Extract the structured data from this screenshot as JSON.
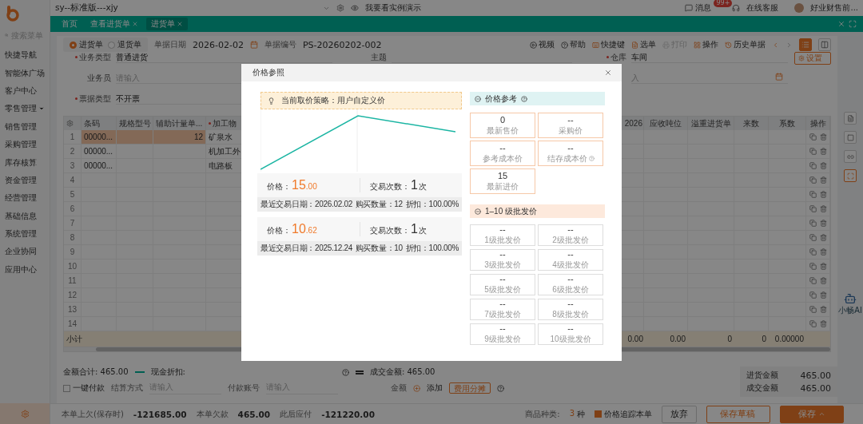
{
  "topbar": {
    "account": "sy--标准版---xjy",
    "demo": "我要看实例演示",
    "messages": "消息",
    "badge": "99+",
    "service": "在线客服",
    "user": "好业财售前..."
  },
  "sidebar": {
    "search_placeholder": "搜索菜单",
    "items": [
      {
        "label": "快捷导航",
        "kind": "item"
      },
      {
        "label": "智能体广场",
        "kind": "item"
      },
      {
        "label": "客户中心",
        "kind": "item"
      },
      {
        "label": "零售管理",
        "kind": "submenu"
      },
      {
        "label": "销售管理",
        "kind": "item"
      },
      {
        "label": "采购管理",
        "kind": "item"
      },
      {
        "label": "库存核算",
        "kind": "item"
      },
      {
        "label": "资金管理",
        "kind": "item"
      },
      {
        "label": "经营管理",
        "kind": "item"
      },
      {
        "label": "基础信息",
        "kind": "item"
      },
      {
        "label": "系统管理",
        "kind": "item"
      },
      {
        "label": "企业协同",
        "kind": "item"
      },
      {
        "label": "应用中心",
        "kind": "item"
      }
    ]
  },
  "tabs": [
    {
      "label": "首页",
      "selected": false,
      "closable": false
    },
    {
      "label": "查看进货单",
      "selected": false,
      "closable": true
    },
    {
      "label": "进货单",
      "selected": true,
      "closable": true
    }
  ],
  "form": {
    "types": [
      {
        "label": "进货单",
        "selected": true
      },
      {
        "label": "退货单",
        "selected": false
      }
    ],
    "date_label": "单据日期",
    "date": "2026-02-02",
    "number_label": "单据编号",
    "number": "PS-20260202-002",
    "actions": [
      {
        "label": "视频",
        "kind": "link",
        "disabled": false
      },
      {
        "label": "帮助",
        "kind": "link",
        "disabled": false
      },
      {
        "label": "快捷键",
        "kind": "tool",
        "disabled": false
      },
      {
        "label": "选单",
        "kind": "tool",
        "disabled": false
      },
      {
        "label": "打印",
        "kind": "tool",
        "disabled": true
      },
      {
        "label": "操作",
        "kind": "tool",
        "disabled": false
      },
      {
        "label": "历史单据",
        "kind": "tool",
        "disabled": false
      }
    ],
    "settings_button": "设置",
    "field_rows": [
      {
        "fields": [
          {
            "label": "业务类型",
            "value": "普通进货",
            "required": true,
            "kind": "text"
          },
          {
            "label": "主题",
            "required": false,
            "kind": "text"
          },
          {
            "label": "仓库",
            "value": "车间",
            "required": true,
            "kind": "text"
          }
        ]
      },
      {
        "fields": [
          {
            "label": "业务员",
            "placeholder": "请输入",
            "required": false,
            "kind": "text"
          },
          {
            "placeholder": "入",
            "required": false,
            "kind": "date"
          }
        ]
      },
      {
        "fields": [
          {
            "label": "票据类型",
            "value": "不开票",
            "required": true,
            "kind": "text"
          }
        ]
      }
    ]
  },
  "table": {
    "columns": [
      {
        "label": "条码"
      },
      {
        "label": "规格型号"
      },
      {
        "label": "辅助计量单..."
      },
      {
        "label": "加工物",
        "required": true
      },
      {
        "label": "2026"
      },
      {
        "label": "应收吨位"
      },
      {
        "label": "溢重进货单"
      },
      {
        "label": "来数"
      },
      {
        "label": "系数"
      },
      {
        "label": "操作"
      }
    ],
    "rows": [
      {
        "no": "1",
        "barcode": "00000...",
        "aux_qty": "12",
        "item": "矿泉水",
        "selected": true
      },
      {
        "no": "2",
        "barcode": "00000...",
        "item": "机加工外",
        "selected": false
      },
      {
        "no": "3",
        "barcode": "00000...",
        "item": "电路板",
        "selected": false
      },
      {
        "no": "4",
        "selected": false
      },
      {
        "no": "5",
        "selected": false
      },
      {
        "no": "6",
        "selected": false
      },
      {
        "no": "7",
        "selected": false
      },
      {
        "no": "8",
        "selected": false
      },
      {
        "no": "9",
        "selected": false
      },
      {
        "no": "10",
        "selected": false
      },
      {
        "no": "11",
        "selected": false
      },
      {
        "no": "12",
        "selected": false
      },
      {
        "no": "13",
        "selected": false
      },
      {
        "no": "14",
        "selected": false
      }
    ],
    "subtotal": {
      "label": "小计",
      "values": [
        "0.00",
        "0.00",
        "0",
        "0",
        "0.00000"
      ]
    }
  },
  "summary": {
    "total": "金额合计: 465.00",
    "discount": "现金折扣:",
    "deal": "成交金额: 465.00",
    "one_click": {
      "label": "一键付款",
      "checked": false
    },
    "method_label": "结算方式",
    "method_placeholder": "请输入",
    "account_label": "付款账号",
    "account_placeholder": "请输入",
    "amount_label": "金额",
    "add": "添加",
    "split": "费用分摊",
    "box": [
      {
        "label": "进货金额",
        "value": "465.00"
      },
      {
        "label": "成交金额",
        "value": "465.00"
      }
    ]
  },
  "footer": {
    "prev_debt_label": "本单上欠(保存时)",
    "prev_debt": "-121685.00",
    "debt_label": "本单欠款",
    "debt": "465.00",
    "after_label": "此后应付",
    "after": "-121220.00",
    "kinds_label": "商品种类:",
    "kinds": "3",
    "kinds_unit": "种",
    "track": {
      "label": "价格追踪本单",
      "checked": true
    },
    "buttons": [
      {
        "label": "放弃",
        "kind": "plain"
      },
      {
        "label": "保存草稿",
        "kind": "outline"
      },
      {
        "label": "保存",
        "kind": "primary"
      }
    ]
  },
  "assistant": "小畅AI",
  "modal": {
    "title": "价格参照",
    "strategy": "当前取价策略：用户自定义价",
    "records": [
      {
        "price_label": "价格：",
        "price": "15",
        "price_decimal": ".00",
        "count_label": "交易次数：",
        "count": "1",
        "count_unit": "次",
        "date": "最近交易日期：2026.02.02",
        "qty": "购买数量：12",
        "discount": "折扣：100.00%"
      },
      {
        "price_label": "价格：",
        "price": "10",
        "price_decimal": ".62",
        "count_label": "交易次数：",
        "count": "1",
        "count_unit": "次",
        "date": "最近交易日期：2025.12.24",
        "qty": "购买数量：10",
        "discount": "折扣：100.00%"
      }
    ],
    "reference_title": "价格参考",
    "reference_cards": [
      {
        "value": "0",
        "label": "最新售价",
        "help": false
      },
      {
        "value": "--",
        "label": "采购价",
        "help": false
      },
      {
        "value": "--",
        "label": "参考成本价",
        "help": false
      },
      {
        "value": "--",
        "label": "结存成本价",
        "help": true
      },
      {
        "value": "15",
        "label": "最新进价",
        "help": false
      }
    ],
    "wholesale_title": "1–10 级批发价",
    "wholesale_cards": [
      {
        "value": "--",
        "label": "1级批发价"
      },
      {
        "value": "--",
        "label": "2级批发价"
      },
      {
        "value": "--",
        "label": "3级批发价"
      },
      {
        "value": "--",
        "label": "4级批发价"
      },
      {
        "value": "--",
        "label": "5级批发价"
      },
      {
        "value": "--",
        "label": "6级批发价"
      },
      {
        "value": "--",
        "label": "7级批发价"
      },
      {
        "value": "--",
        "label": "8级批发价"
      },
      {
        "value": "--",
        "label": "9级批发价"
      },
      {
        "value": "--",
        "label": "10级批发价"
      }
    ]
  }
}
